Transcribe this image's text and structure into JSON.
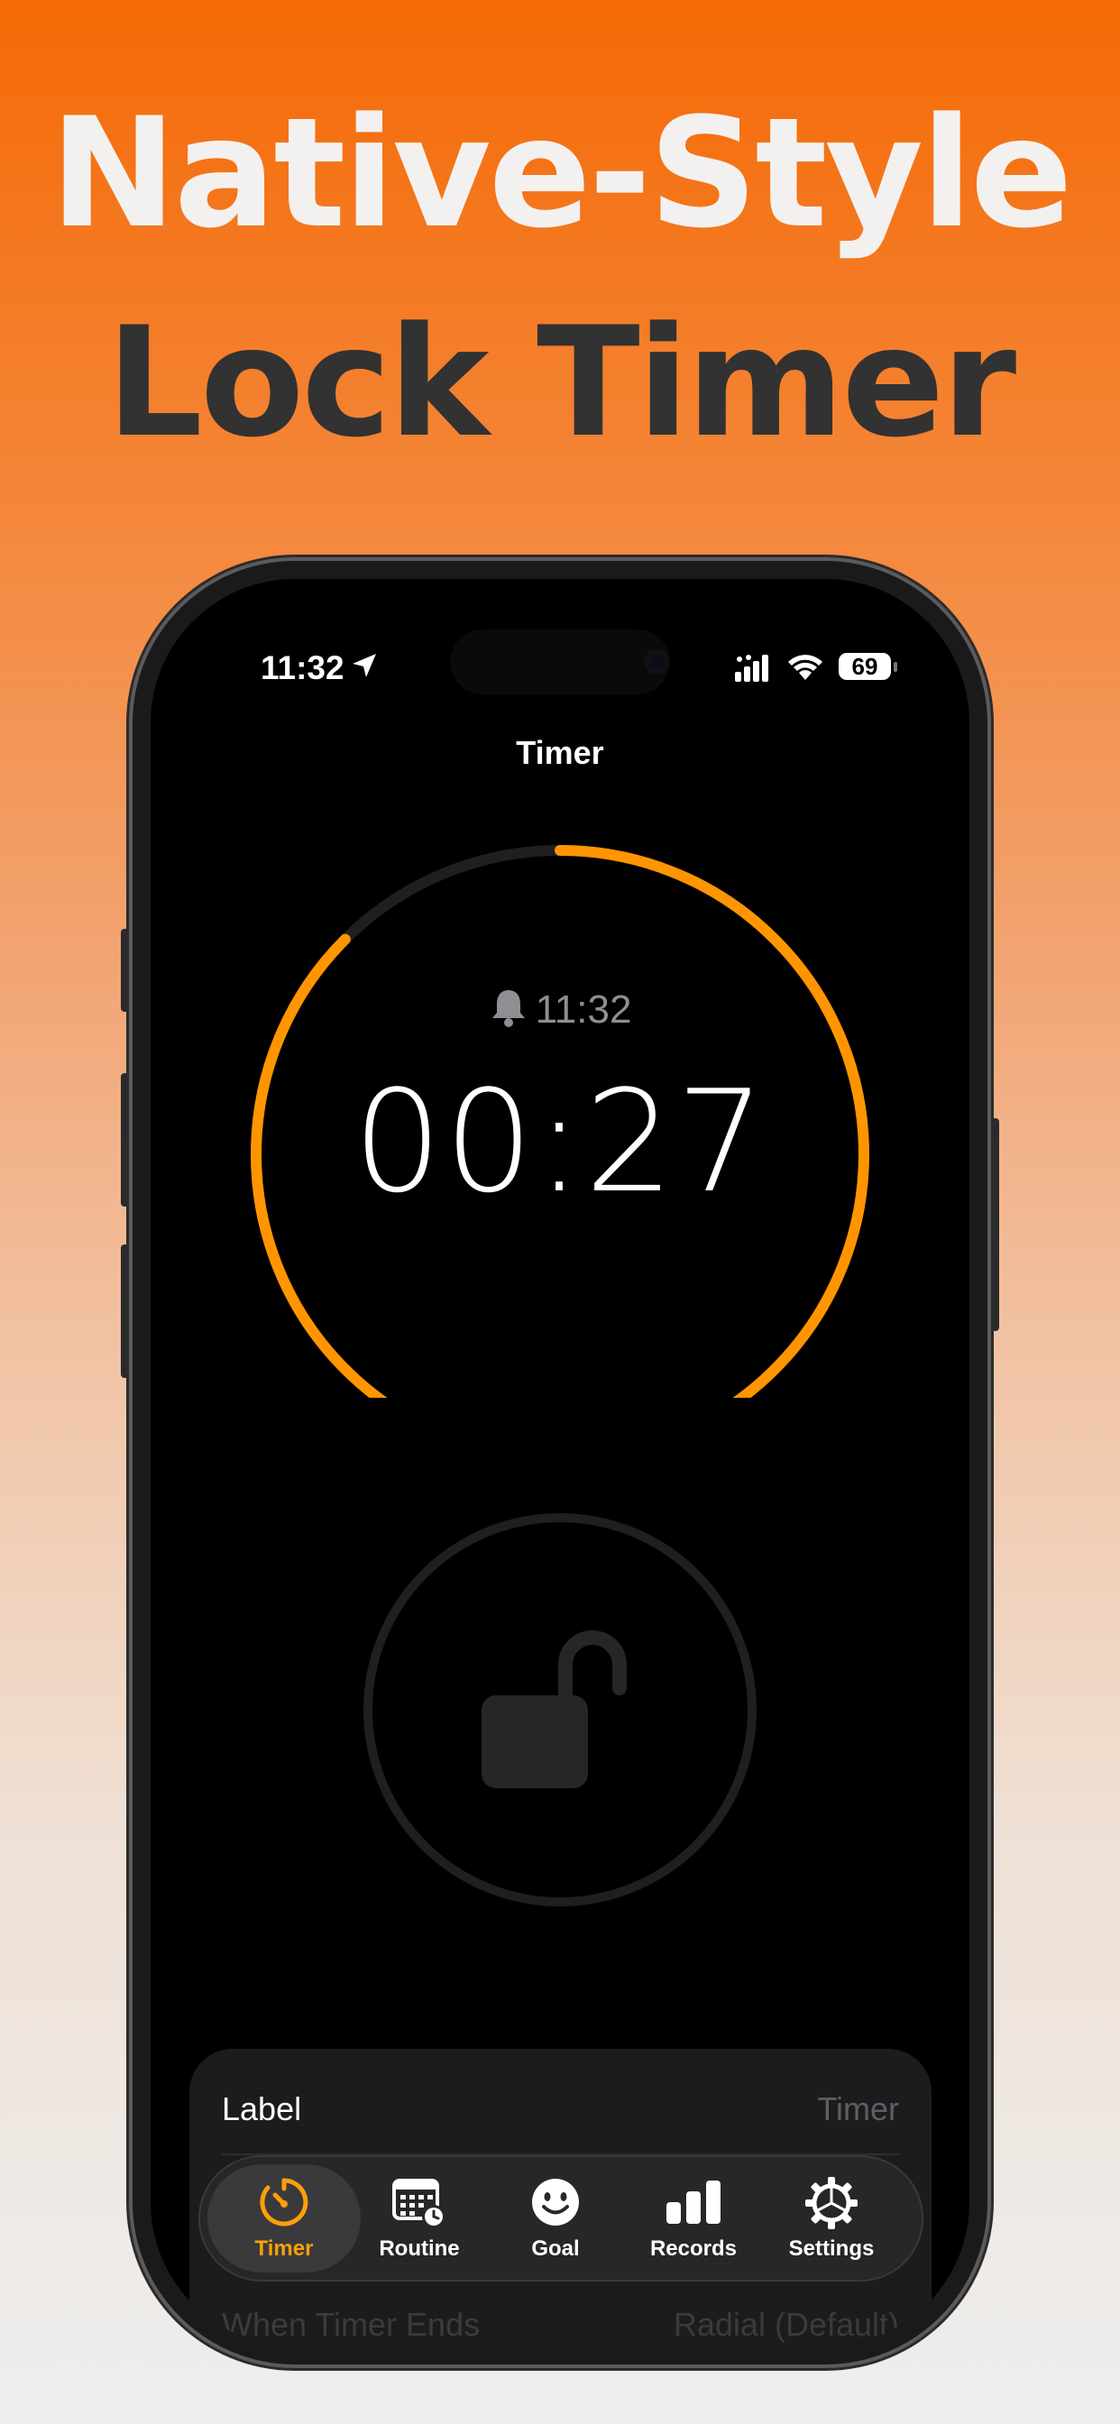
{
  "headline": {
    "line1": "Native-Style",
    "line2": "Lock Timer"
  },
  "status_bar": {
    "time": "11:32",
    "battery": "69"
  },
  "screen": {
    "title": "Timer",
    "alarm_time": "11:32",
    "countdown": "00:27",
    "progress_remaining_fraction": 0.875
  },
  "settings_sheet": {
    "rows": [
      {
        "label": "Label",
        "value": "Timer"
      },
      {
        "label": "When Timer Ends",
        "value": "Radial (Default)"
      }
    ]
  },
  "tab_bar": {
    "items": [
      {
        "label": "Timer",
        "icon": "timer-icon",
        "active": true
      },
      {
        "label": "Routine",
        "icon": "calendar-clock-icon",
        "active": false
      },
      {
        "label": "Goal",
        "icon": "smiley-icon",
        "active": false
      },
      {
        "label": "Records",
        "icon": "bar-chart-icon",
        "active": false
      },
      {
        "label": "Settings",
        "icon": "gear-icon",
        "active": false
      }
    ]
  },
  "colors": {
    "accent": "#ff9500",
    "track": "#1f1f1f",
    "background": "#000000"
  }
}
